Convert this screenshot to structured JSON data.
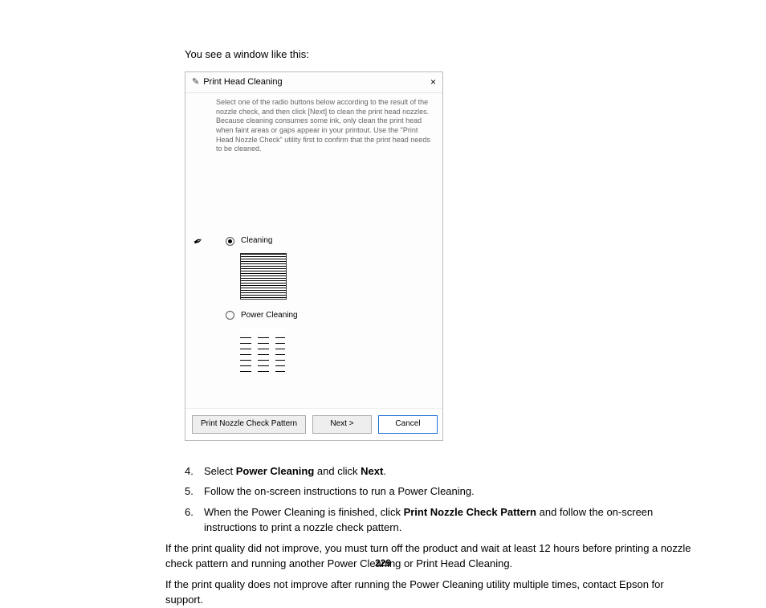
{
  "intro": "You see a window like this:",
  "window": {
    "title": "Print Head Cleaning",
    "close": "×",
    "description": "Select one of the radio buttons below according to the result of the nozzle check, and then click [Next] to clean the print head nozzles. Because cleaning consumes some ink, only clean the print head when faint areas or gaps appear in your printout. Use the \"Print Head Nozzle Check\" utility first to confirm that the print head needs to be cleaned.",
    "option_cleaning": "Cleaning",
    "option_power": "Power Cleaning",
    "btn_pattern": "Print Nozzle Check Pattern",
    "btn_next": "Next >",
    "btn_cancel": "Cancel"
  },
  "steps": {
    "s4a": "Select ",
    "s4b": "Power Cleaning",
    "s4c": " and click ",
    "s4d": "Next",
    "s4e": ".",
    "s5": "Follow the on-screen instructions to run a Power Cleaning.",
    "s6a": "When the Power Cleaning is finished, click ",
    "s6b": "Print Nozzle Check Pattern",
    "s6c": " and follow the on-screen instructions to print a nozzle check pattern."
  },
  "para1": "If the print quality did not improve, you must turn off the product and wait at least 12 hours before printing a nozzle check pattern and running another Power Cleaning or Print Head Cleaning.",
  "para2": "If the print quality does not improve after running the Power Cleaning utility multiple times, contact Epson for support.",
  "page_number": "229"
}
